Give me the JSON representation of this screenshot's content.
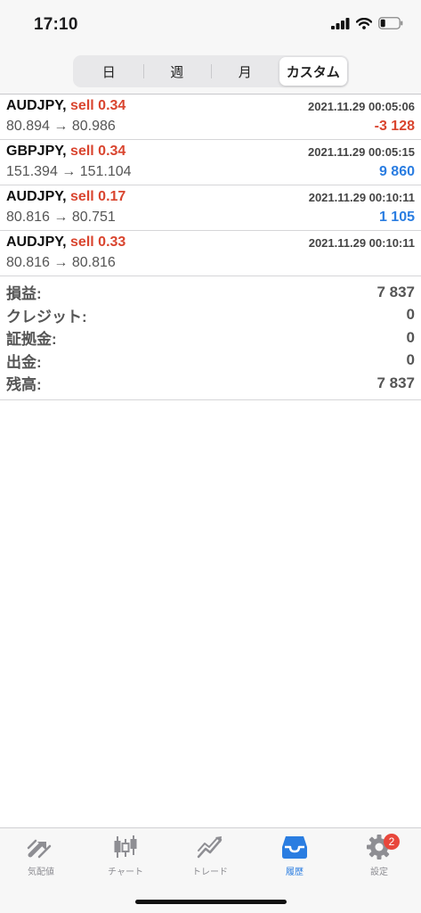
{
  "status": {
    "time": "17:10"
  },
  "segments": [
    {
      "label": "日",
      "active": false
    },
    {
      "label": "週",
      "active": false
    },
    {
      "label": "月",
      "active": false
    },
    {
      "label": "カスタム",
      "active": true
    }
  ],
  "deals": [
    {
      "symbol": "AUDJPY,",
      "side": "sell 0.34",
      "time": "2021.11.29 00:05:06",
      "prices": "80.894 → 80.986",
      "profit": "-3 128",
      "profit_color": "#d9452f"
    },
    {
      "symbol": "GBPJPY,",
      "side": "sell 0.34",
      "time": "2021.11.29 00:05:15",
      "prices": "151.394 → 151.104",
      "profit": "9 860",
      "profit_color": "#2a7de1"
    },
    {
      "symbol": "AUDJPY,",
      "side": "sell 0.17",
      "time": "2021.11.29 00:10:11",
      "prices": "80.816 → 80.751",
      "profit": "1 105",
      "profit_color": "#2a7de1"
    },
    {
      "symbol": "AUDJPY,",
      "side": "sell 0.33",
      "time": "2021.11.29 00:10:11",
      "prices": "80.816 → 80.816",
      "profit": "",
      "profit_color": "#2a7de1"
    }
  ],
  "summary": [
    {
      "label": "損益:",
      "value": "7 837"
    },
    {
      "label": "クレジット:",
      "value": "0"
    },
    {
      "label": "証拠金:",
      "value": "0"
    },
    {
      "label": "出金:",
      "value": "0"
    },
    {
      "label": "残高:",
      "value": "7 837"
    }
  ],
  "tabs": [
    {
      "label": "気配値",
      "icon": "quotes-icon",
      "active": false
    },
    {
      "label": "チャート",
      "icon": "chart-icon",
      "active": false
    },
    {
      "label": "トレード",
      "icon": "trade-icon",
      "active": false
    },
    {
      "label": "履歴",
      "icon": "history-icon",
      "active": true
    },
    {
      "label": "設定",
      "icon": "settings-icon",
      "active": false,
      "badge": "2"
    }
  ],
  "colors": {
    "sell": "#d9452f",
    "loss": "#d9452f",
    "profit": "#2a7de1",
    "active_tab": "#2a7de1"
  }
}
